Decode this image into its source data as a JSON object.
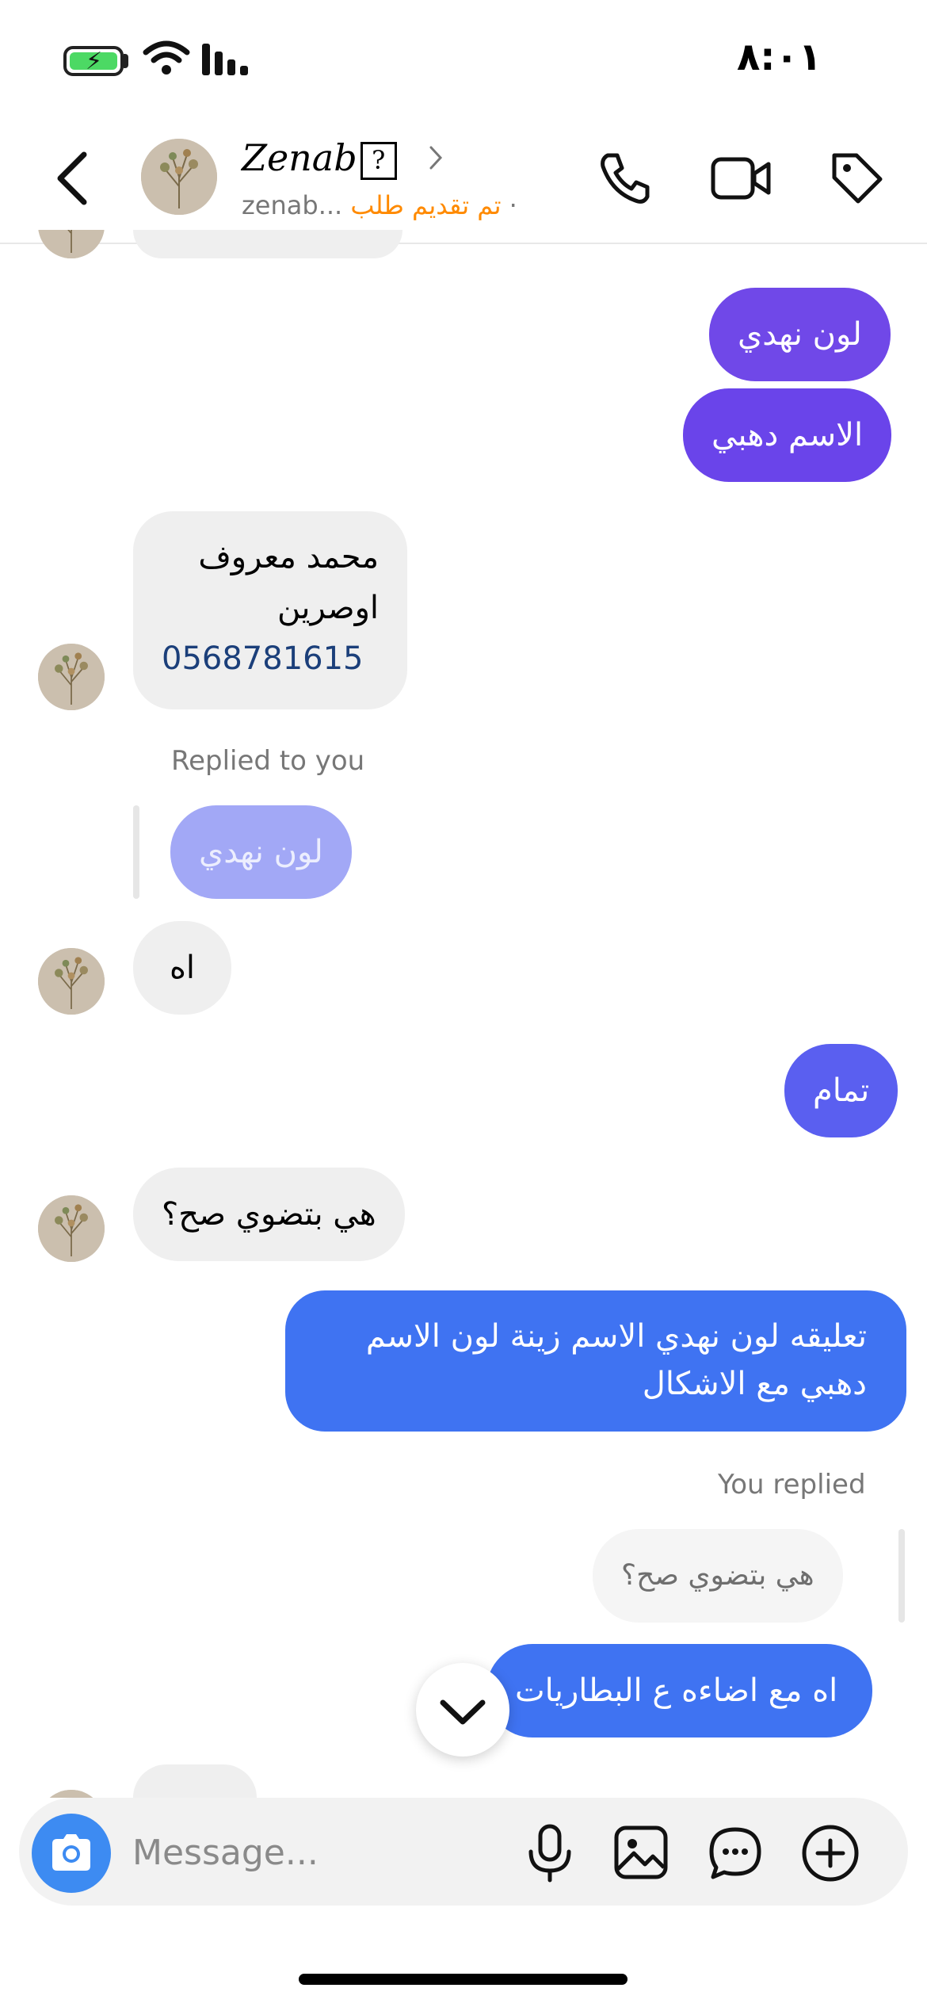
{
  "status_bar": {
    "time": "٨:٠١"
  },
  "header": {
    "contact_name": "Zenab",
    "name_badge": "?",
    "status_dot": "·",
    "status_text": "تم تقديم طلب",
    "username": "zenab..."
  },
  "messages": {
    "m1": "لون نهدي",
    "m2": "الاسم دهبي",
    "m3_line1": "محمد معروف",
    "m3_line2": "اوصرين",
    "m3_phone": "0568781615",
    "reply1_label": "Replied to you",
    "reply1_quote": "لون نهدي",
    "m4": "اه",
    "m5": "تمام",
    "m6": "هي بتضوي صح؟",
    "m7_line1": "تعليقه لون نهدي الاسم زينة لون الاسم",
    "m7_line2": "دهبي مع الاشكال",
    "reply2_label": "You replied",
    "reply2_quote": "هي بتضوي صح؟",
    "m8": "اه مع اضاءه ع البطاريات"
  },
  "composer": {
    "placeholder": "Message..."
  },
  "colors": {
    "accent_purple": "#7048e8",
    "accent_blue": "#3f73f2",
    "incoming_bg": "#efefef",
    "status_orange": "#ff8a00",
    "camera_blue": "#3d8bf2"
  },
  "icons": [
    "back-icon",
    "chevron-right-icon",
    "phone-icon",
    "video-icon",
    "tag-icon",
    "chevron-down-icon",
    "camera-icon",
    "microphone-icon",
    "gallery-icon",
    "sticker-icon",
    "plus-icon"
  ]
}
